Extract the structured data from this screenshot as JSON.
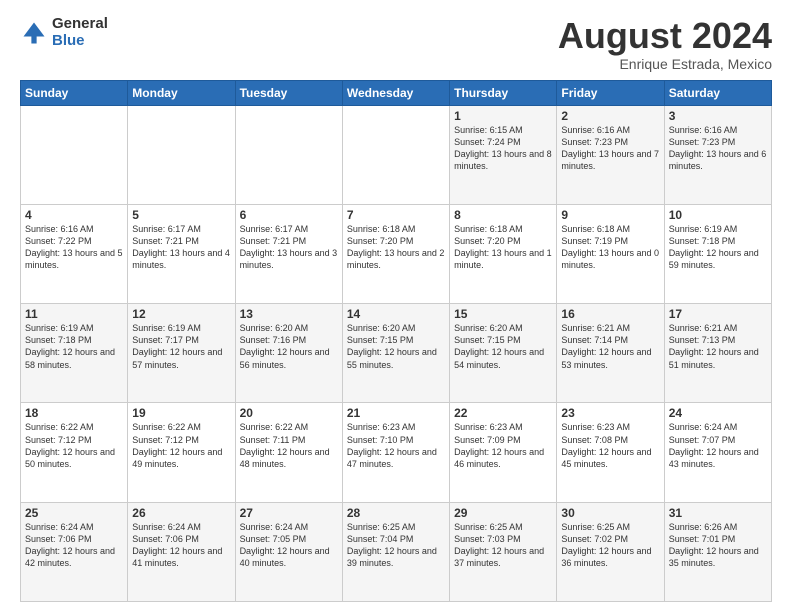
{
  "logo": {
    "general": "General",
    "blue": "Blue"
  },
  "title": "August 2024",
  "subtitle": "Enrique Estrada, Mexico",
  "days_of_week": [
    "Sunday",
    "Monday",
    "Tuesday",
    "Wednesday",
    "Thursday",
    "Friday",
    "Saturday"
  ],
  "weeks": [
    [
      {
        "day": "",
        "info": ""
      },
      {
        "day": "",
        "info": ""
      },
      {
        "day": "",
        "info": ""
      },
      {
        "day": "",
        "info": ""
      },
      {
        "day": "1",
        "info": "Sunrise: 6:15 AM\nSunset: 7:24 PM\nDaylight: 13 hours\nand 8 minutes."
      },
      {
        "day": "2",
        "info": "Sunrise: 6:16 AM\nSunset: 7:23 PM\nDaylight: 13 hours\nand 7 minutes."
      },
      {
        "day": "3",
        "info": "Sunrise: 6:16 AM\nSunset: 7:23 PM\nDaylight: 13 hours\nand 6 minutes."
      }
    ],
    [
      {
        "day": "4",
        "info": "Sunrise: 6:16 AM\nSunset: 7:22 PM\nDaylight: 13 hours\nand 5 minutes."
      },
      {
        "day": "5",
        "info": "Sunrise: 6:17 AM\nSunset: 7:21 PM\nDaylight: 13 hours\nand 4 minutes."
      },
      {
        "day": "6",
        "info": "Sunrise: 6:17 AM\nSunset: 7:21 PM\nDaylight: 13 hours\nand 3 minutes."
      },
      {
        "day": "7",
        "info": "Sunrise: 6:18 AM\nSunset: 7:20 PM\nDaylight: 13 hours\nand 2 minutes."
      },
      {
        "day": "8",
        "info": "Sunrise: 6:18 AM\nSunset: 7:20 PM\nDaylight: 13 hours\nand 1 minute."
      },
      {
        "day": "9",
        "info": "Sunrise: 6:18 AM\nSunset: 7:19 PM\nDaylight: 13 hours\nand 0 minutes."
      },
      {
        "day": "10",
        "info": "Sunrise: 6:19 AM\nSunset: 7:18 PM\nDaylight: 12 hours\nand 59 minutes."
      }
    ],
    [
      {
        "day": "11",
        "info": "Sunrise: 6:19 AM\nSunset: 7:18 PM\nDaylight: 12 hours\nand 58 minutes."
      },
      {
        "day": "12",
        "info": "Sunrise: 6:19 AM\nSunset: 7:17 PM\nDaylight: 12 hours\nand 57 minutes."
      },
      {
        "day": "13",
        "info": "Sunrise: 6:20 AM\nSunset: 7:16 PM\nDaylight: 12 hours\nand 56 minutes."
      },
      {
        "day": "14",
        "info": "Sunrise: 6:20 AM\nSunset: 7:15 PM\nDaylight: 12 hours\nand 55 minutes."
      },
      {
        "day": "15",
        "info": "Sunrise: 6:20 AM\nSunset: 7:15 PM\nDaylight: 12 hours\nand 54 minutes."
      },
      {
        "day": "16",
        "info": "Sunrise: 6:21 AM\nSunset: 7:14 PM\nDaylight: 12 hours\nand 53 minutes."
      },
      {
        "day": "17",
        "info": "Sunrise: 6:21 AM\nSunset: 7:13 PM\nDaylight: 12 hours\nand 51 minutes."
      }
    ],
    [
      {
        "day": "18",
        "info": "Sunrise: 6:22 AM\nSunset: 7:12 PM\nDaylight: 12 hours\nand 50 minutes."
      },
      {
        "day": "19",
        "info": "Sunrise: 6:22 AM\nSunset: 7:12 PM\nDaylight: 12 hours\nand 49 minutes."
      },
      {
        "day": "20",
        "info": "Sunrise: 6:22 AM\nSunset: 7:11 PM\nDaylight: 12 hours\nand 48 minutes."
      },
      {
        "day": "21",
        "info": "Sunrise: 6:23 AM\nSunset: 7:10 PM\nDaylight: 12 hours\nand 47 minutes."
      },
      {
        "day": "22",
        "info": "Sunrise: 6:23 AM\nSunset: 7:09 PM\nDaylight: 12 hours\nand 46 minutes."
      },
      {
        "day": "23",
        "info": "Sunrise: 6:23 AM\nSunset: 7:08 PM\nDaylight: 12 hours\nand 45 minutes."
      },
      {
        "day": "24",
        "info": "Sunrise: 6:24 AM\nSunset: 7:07 PM\nDaylight: 12 hours\nand 43 minutes."
      }
    ],
    [
      {
        "day": "25",
        "info": "Sunrise: 6:24 AM\nSunset: 7:06 PM\nDaylight: 12 hours\nand 42 minutes."
      },
      {
        "day": "26",
        "info": "Sunrise: 6:24 AM\nSunset: 7:06 PM\nDaylight: 12 hours\nand 41 minutes."
      },
      {
        "day": "27",
        "info": "Sunrise: 6:24 AM\nSunset: 7:05 PM\nDaylight: 12 hours\nand 40 minutes."
      },
      {
        "day": "28",
        "info": "Sunrise: 6:25 AM\nSunset: 7:04 PM\nDaylight: 12 hours\nand 39 minutes."
      },
      {
        "day": "29",
        "info": "Sunrise: 6:25 AM\nSunset: 7:03 PM\nDaylight: 12 hours\nand 37 minutes."
      },
      {
        "day": "30",
        "info": "Sunrise: 6:25 AM\nSunset: 7:02 PM\nDaylight: 12 hours\nand 36 minutes."
      },
      {
        "day": "31",
        "info": "Sunrise: 6:26 AM\nSunset: 7:01 PM\nDaylight: 12 hours\nand 35 minutes."
      }
    ]
  ],
  "colors": {
    "header_bg": "#2a6db5",
    "header_text": "#ffffff",
    "odd_row": "#f5f5f5",
    "even_row": "#ffffff"
  }
}
